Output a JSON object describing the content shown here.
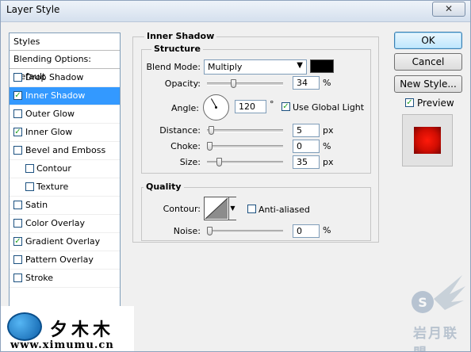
{
  "window": {
    "title": "Layer Style",
    "close_glyph": "✕"
  },
  "styles_panel": {
    "header": "Styles",
    "blending_options": "Blending Options: Default",
    "effects": [
      {
        "label": "Drop Shadow",
        "checked": false,
        "selected": false,
        "indent": false
      },
      {
        "label": "Inner Shadow",
        "checked": true,
        "selected": true,
        "indent": false
      },
      {
        "label": "Outer Glow",
        "checked": false,
        "selected": false,
        "indent": false
      },
      {
        "label": "Inner Glow",
        "checked": true,
        "selected": false,
        "indent": false
      },
      {
        "label": "Bevel and Emboss",
        "checked": false,
        "selected": false,
        "indent": false
      },
      {
        "label": "Contour",
        "checked": false,
        "selected": false,
        "indent": true
      },
      {
        "label": "Texture",
        "checked": false,
        "selected": false,
        "indent": true
      },
      {
        "label": "Satin",
        "checked": false,
        "selected": false,
        "indent": false
      },
      {
        "label": "Color Overlay",
        "checked": false,
        "selected": false,
        "indent": false
      },
      {
        "label": "Gradient Overlay",
        "checked": true,
        "selected": false,
        "indent": false
      },
      {
        "label": "Pattern Overlay",
        "checked": false,
        "selected": false,
        "indent": false
      },
      {
        "label": "Stroke",
        "checked": false,
        "selected": false,
        "indent": false
      }
    ]
  },
  "inner_shadow": {
    "section_title": "Inner Shadow",
    "structure": {
      "title": "Structure",
      "blend_mode_label": "Blend Mode:",
      "blend_mode_value": "Multiply",
      "color": "#000000",
      "opacity_label": "Opacity:",
      "opacity_value": "34",
      "opacity_unit": "%",
      "opacity_level": 0.34,
      "angle_label": "Angle:",
      "angle_value": "120",
      "angle_unit": "°",
      "use_global_light_label": "Use Global Light",
      "use_global_light": true,
      "distance_label": "Distance:",
      "distance_value": "5",
      "distance_unit": "px",
      "distance_level": 0.02,
      "choke_label": "Choke:",
      "choke_value": "0",
      "choke_unit": "%",
      "choke_level": 0.0,
      "size_label": "Size:",
      "size_value": "35",
      "size_unit": "px",
      "size_level": 0.14
    },
    "quality": {
      "title": "Quality",
      "contour_label": "Contour:",
      "anti_aliased_label": "Anti-aliased",
      "anti_aliased": false,
      "noise_label": "Noise:",
      "noise_value": "0",
      "noise_unit": "%",
      "noise_level": 0.0
    }
  },
  "buttons": {
    "ok": "OK",
    "cancel": "Cancel",
    "new_style": "New Style...",
    "preview_label": "Preview",
    "preview_checked": true
  },
  "watermarks": {
    "left_text": "夕木木",
    "left_url": "www.ximumu.cn",
    "right_text": "岩月联盟"
  },
  "colors": {
    "selection": "#3399ff",
    "preview_red": "#e01205"
  }
}
